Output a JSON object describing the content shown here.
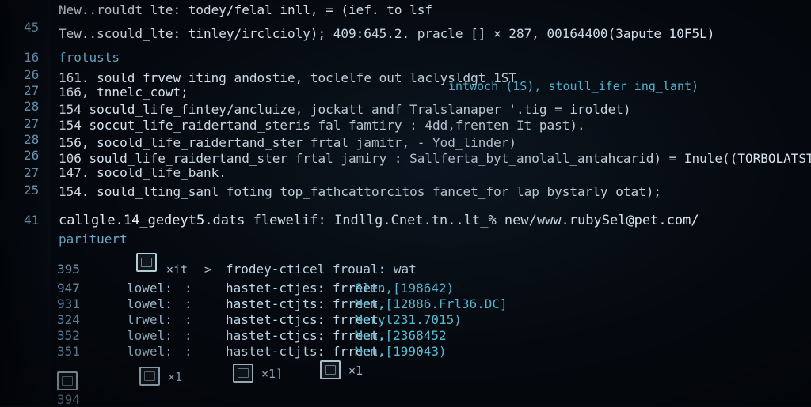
{
  "lines": [
    {
      "num": "",
      "text": "New..rouldt_lte:  todey/felal_inll,  =  (ief. to lsf"
    },
    {
      "num": "45",
      "text": "Tew..scould_lte:  tinley/irclcioly);  409:645.2. pracle [] × 287,  00164400(3apute 10F5L)"
    },
    {
      "num": "16",
      "text": "frotusts"
    },
    {
      "num": "26",
      "text": "161.   sould_frvew_iting_andostie,  toclelfe out laclysldgt_1ST",
      "extra": "intwoch (1S), stoull_ifer ing_lant)"
    },
    {
      "num": "27",
      "text": "166,   tnnelc_cowt;"
    },
    {
      "num": "28",
      "text": "154   soculd_life_fintey/ancluize,  jockatt andf Tralslanaper '.tig = iroldet)"
    },
    {
      "num": "27",
      "text": "154   soccut_life_raidertand_steris fal famtiry :  4dd,frenten It past)."
    },
    {
      "num": "28",
      "text": "156,   socold_life_raidertand_ster frtal jamitr,  -  Yod_linder)"
    },
    {
      "num": "26",
      "text": "106   sould_life_raidertand_ster frtal jamiry :  Sallferta_byt_anolall_antahcarid)  =  Inule((TORBOLATST)"
    },
    {
      "num": "27",
      "text": "147.   socold_life_bank."
    },
    {
      "num": "25",
      "text": "154.   sould_lting_sanl foting top_fathcattorcitos fancet_for lap bystarly otat);"
    }
  ],
  "line41": {
    "num": "41",
    "text": "callgle.14_gedeyt5.dats flewelif:  Indllg.Cnet.tn..lt_%  new/www.rubySel@pet.com/"
  },
  "parituert": "parituert",
  "tree_header": {
    "num": "395",
    "folder_label": "×it",
    "arrow": ">",
    "text": "frodey-cticel froual: wat"
  },
  "tree_rows": [
    {
      "num": "947",
      "lvl": "lowel:",
      "col": ":",
      "key": "hastet-ctjes: frreet.",
      "val": "Slen,[198642)"
    },
    {
      "num": "931",
      "lvl": "lowel:",
      "col": ":",
      "key": "hastet-ctjts: frreet.",
      "val": "Men,[12886.Frl36.DC]"
    },
    {
      "num": "324",
      "lvl": "lrwel:",
      "col": ":",
      "key": "hastet-ctjcs: frreet.",
      "val": "Meryl231.7015)"
    },
    {
      "num": "352",
      "lvl": "lowel:",
      "col": ":",
      "key": "hastet-ctjcs: frreet.",
      "val": "Men,[2368452"
    },
    {
      "num": "351",
      "lvl": "lowel:",
      "col": ":",
      "key": "hastet-ctjts: frreet.",
      "val": "Men,[199043)"
    }
  ],
  "bottom_folders": [
    {
      "label": ""
    },
    {
      "label": "×1"
    },
    {
      "label": "×1]"
    },
    {
      "label": "×1"
    }
  ],
  "bottom_num": "394",
  "colors": {
    "bg": "#05090f",
    "text": "#d7e3ee",
    "accent": "#56c0d8",
    "line_numbers": "#7aa7c6"
  }
}
